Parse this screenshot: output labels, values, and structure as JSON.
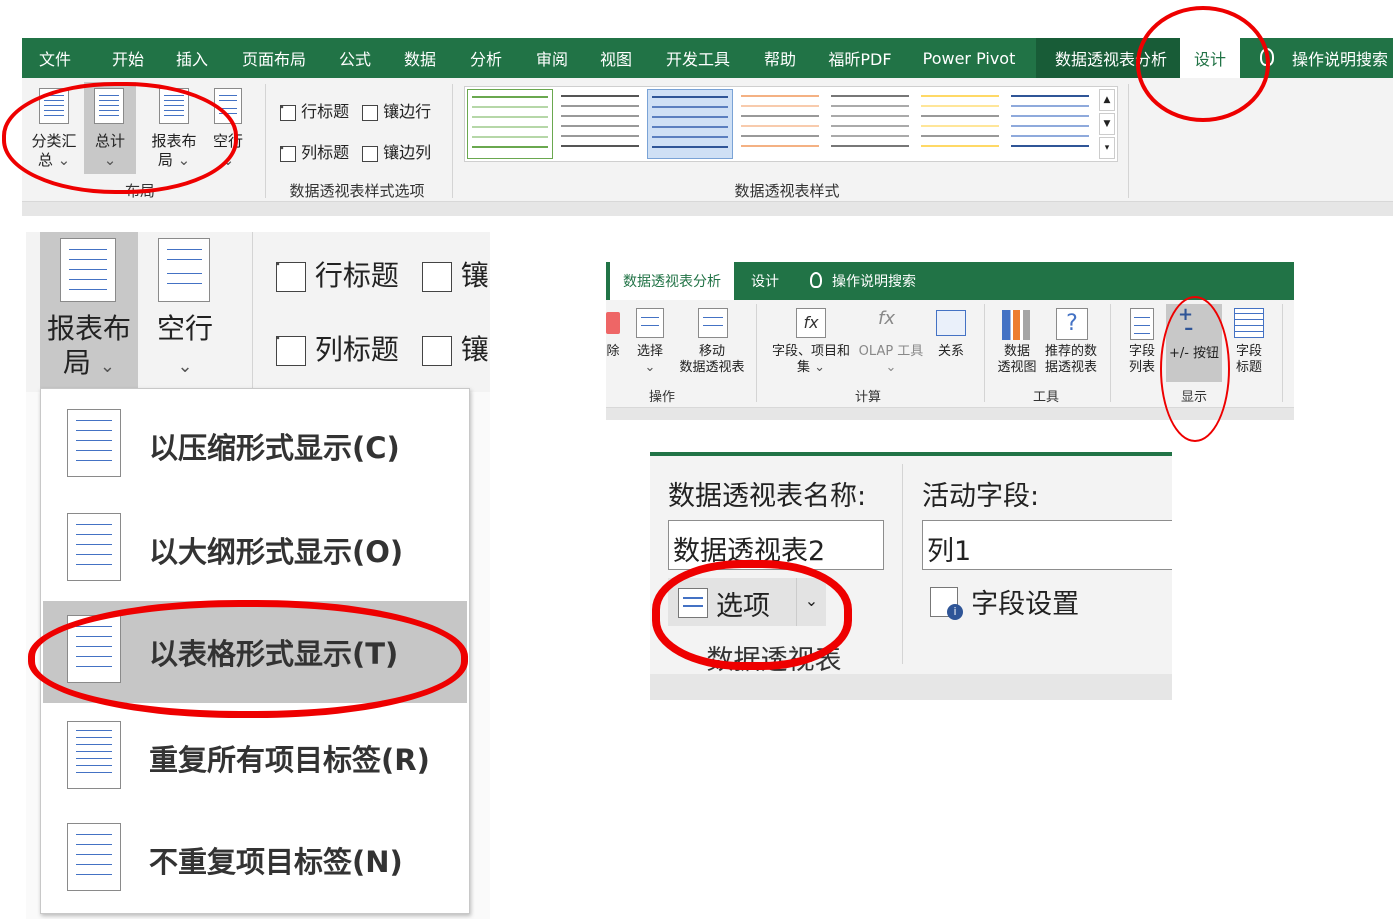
{
  "ribbon1": {
    "tabs": [
      "文件",
      "开始",
      "插入",
      "页面布局",
      "公式",
      "数据",
      "分析",
      "审阅",
      "视图",
      "开发工具",
      "帮助",
      "福昕PDF",
      "Power Pivot",
      "数据透视表分析",
      "设计"
    ],
    "tell_me": "操作说明搜索",
    "layout_buttons": {
      "subtotals": [
        "分类汇",
        "总"
      ],
      "grand_totals": "总计",
      "report_layout": "报表布",
      "report_layout_2": "局",
      "blank_rows": "空行"
    },
    "group_layout": "布局",
    "options": {
      "row_headers": "行标题",
      "banded_rows": "镶边行",
      "column_headers": "列标题",
      "banded_columns": "镶边列"
    },
    "group_options": "数据透视表样式选项",
    "group_styles": "数据透视表样式"
  },
  "zoom": {
    "report_layout": "报表布",
    "report_layout_2": "局",
    "blank_rows": "空行",
    "row_headers": "行标题",
    "column_headers": "列标题",
    "cut_char": "镶",
    "menu": [
      {
        "label": "以压缩形式显示(C)",
        "selected": false
      },
      {
        "label": "以大纲形式显示(O)",
        "selected": false
      },
      {
        "label": "以表格形式显示(T)",
        "selected": true
      },
      {
        "label": "重复所有项目标签(R)",
        "selected": false
      },
      {
        "label": "不重复项目标签(N)",
        "selected": false
      }
    ]
  },
  "ribbon2": {
    "tabs": [
      "数据透视表分析",
      "设计"
    ],
    "tell_me": "操作说明搜索",
    "actions": {
      "clear": "除",
      "select": "选择",
      "move_1": "移动",
      "move_2": "数据透视表"
    },
    "group_actions": "操作",
    "calc": {
      "fields_1": "字段、项目和",
      "fields_2": "集",
      "olap": "OLAP 工具",
      "relationships": "关系"
    },
    "group_calc": "计算",
    "tools": {
      "pivot_chart_1": "数据",
      "pivot_chart_2": "透视图",
      "recommended_1": "推荐的数",
      "recommended_2": "据透视表"
    },
    "group_tools": "工具",
    "show": {
      "field_list_1": "字段",
      "field_list_2": "列表",
      "buttons": "+/- 按钮",
      "headers_1": "字段",
      "headers_2": "标题"
    },
    "group_show": "显示"
  },
  "pivot_panel": {
    "name_label": "数据透视表名称:",
    "name_value": "数据透视表2",
    "options_button": "选项",
    "group_label": "数据透视表",
    "active_field_label": "活动字段:",
    "active_field_value": "列1",
    "field_settings": "字段设置"
  },
  "colors": {
    "excel_green": "#217346",
    "dark_green": "#185c37",
    "highlight_red": "#e00000",
    "menu_selected": "#c6c6c6"
  }
}
